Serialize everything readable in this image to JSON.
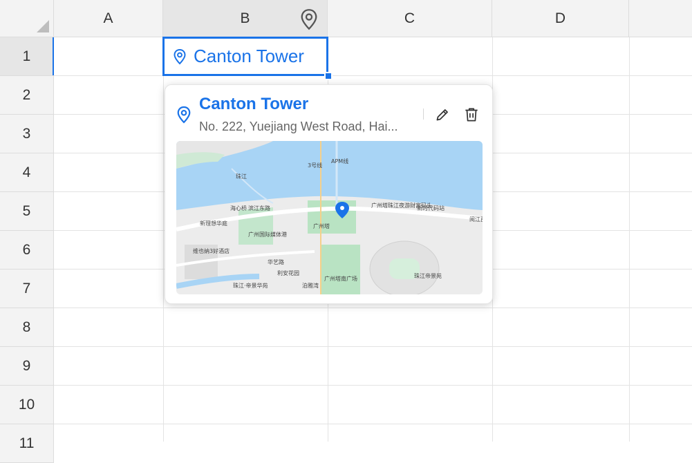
{
  "columns": [
    "A",
    "B",
    "C",
    "D"
  ],
  "rows": [
    "1",
    "2",
    "3",
    "4",
    "5",
    "6",
    "7",
    "8",
    "9",
    "10",
    "11"
  ],
  "selected_cell": {
    "value": "Canton Tower",
    "icon": "location-pin-icon"
  },
  "column_b_icon": "location-pin-icon",
  "card": {
    "title": "Canton Tower",
    "address": "No. 222, Yuejiang West Road, Hai...",
    "actions": {
      "edit_icon": "pencil-icon",
      "delete_icon": "trash-icon"
    },
    "map_labels": {
      "river_1": "珠江",
      "road_1": "滨江东路",
      "road_2": "阅江西路",
      "place_1": "海心桥",
      "place_2": "新理想华庭",
      "place_3": "维也纳3好酒店",
      "place_4": "广州国际媒体港",
      "place_5": "广州塔",
      "place_6": "华艺路",
      "place_7": "利安花园",
      "place_8": "珠江·帝景华苑",
      "place_9": "泊雅湾",
      "place_10": "广州塔南广场",
      "place_11": "广州塔珠江夜游财富码头",
      "place_12": "新时代码站",
      "place_13": "珠江帝景苑",
      "metro": "APM线",
      "line": "3号线"
    }
  },
  "colors": {
    "accent": "#1a73e8",
    "water": "#a8d4f5",
    "park": "#b9e3c3",
    "land": "#eeeeee"
  }
}
